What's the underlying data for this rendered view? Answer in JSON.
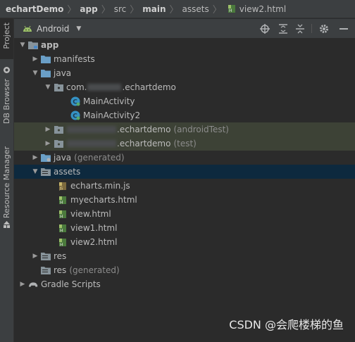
{
  "breadcrumb": [
    "echartDemo",
    "app",
    "src",
    "main",
    "assets",
    "view2.html"
  ],
  "side_tabs": [
    "Project",
    "DB Browser",
    "Resource Manager"
  ],
  "toolbar": {
    "view_mode": "Android"
  },
  "tree": {
    "app": "app",
    "manifests": "manifests",
    "java": "java",
    "pkg_main": {
      "prefix": "com.",
      "suffix": ".echartdemo"
    },
    "main_activity": "MainActivity",
    "main_activity2": "MainActivity2",
    "pkg_android_test": {
      "suffix": ".echartdemo",
      "note": "(androidTest)"
    },
    "pkg_test": {
      "suffix": ".echartdemo",
      "note": "(test)"
    },
    "java_generated": {
      "label": "java",
      "note": "(generated)"
    },
    "assets": "assets",
    "files": [
      "echarts.min.js",
      "myecharts.html",
      "view.html",
      "view1.html",
      "view2.html"
    ],
    "res": "res",
    "res_generated": {
      "label": "res",
      "note": "(generated)"
    },
    "gradle": "Gradle Scripts"
  },
  "watermark": "CSDN @会爬楼梯的鱼"
}
